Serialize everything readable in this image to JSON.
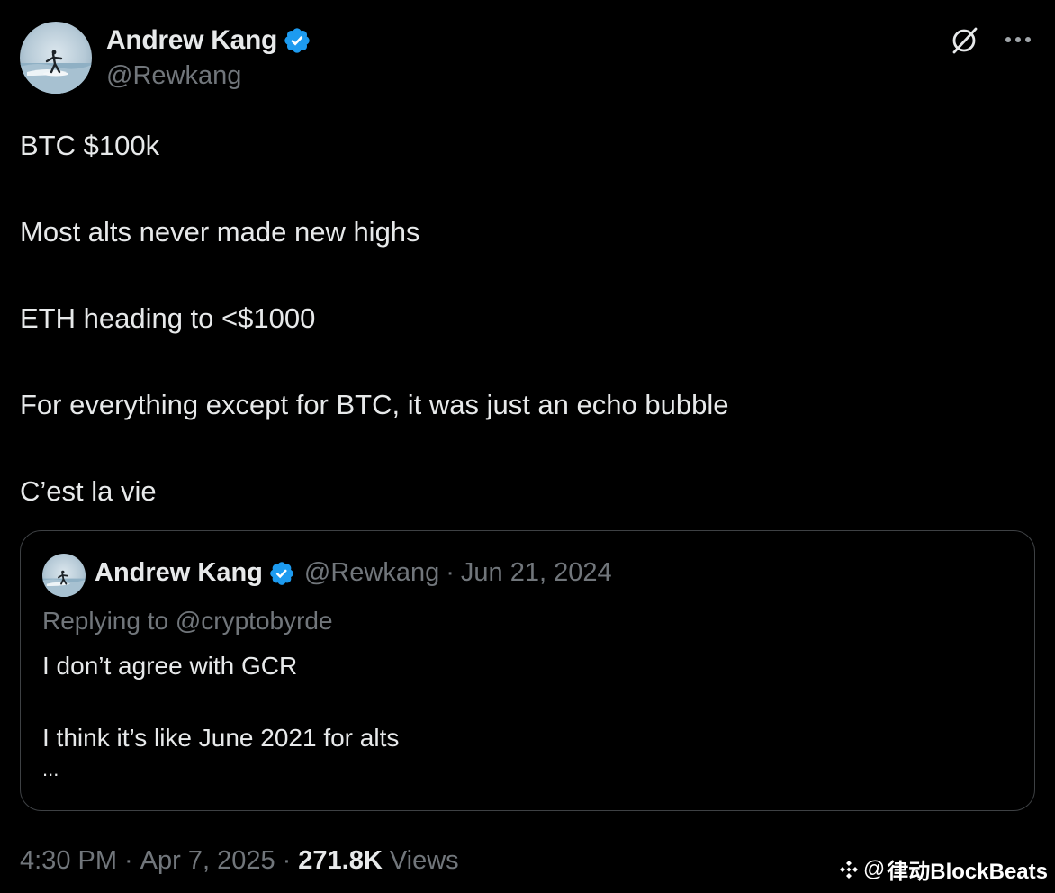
{
  "author": {
    "display_name": "Andrew Kang",
    "handle": "@Rewkang",
    "verified_color": "#1d9bf0"
  },
  "actions": {
    "grok_icon": "grok-icon",
    "more_icon": "more-icon"
  },
  "tweet": {
    "lines": [
      "BTC $100k",
      "Most alts never made new highs",
      "ETH heading to <$1000",
      "For everything except for BTC, it was just an echo bubble",
      "C’est la vie"
    ]
  },
  "quote": {
    "display_name": "Andrew Kang",
    "handle": "@Rewkang",
    "separator": "·",
    "date": "Jun 21, 2024",
    "replying_to": "Replying to @cryptobyrde",
    "lines": [
      "I don’t agree with GCR",
      "I think it’s like June 2021 for alts",
      "..."
    ]
  },
  "meta": {
    "time": "4:30 PM",
    "separator": "·",
    "date": "Apr 7, 2025",
    "views_count": "271.8K",
    "views_label": "Views"
  },
  "watermark": {
    "at": "@",
    "text": "律动BlockBeats"
  },
  "colors": {
    "background": "#000000",
    "text": "#e7e9ea",
    "secondary": "#71767b",
    "border": "#3e4144",
    "verified": "#1d9bf0"
  }
}
